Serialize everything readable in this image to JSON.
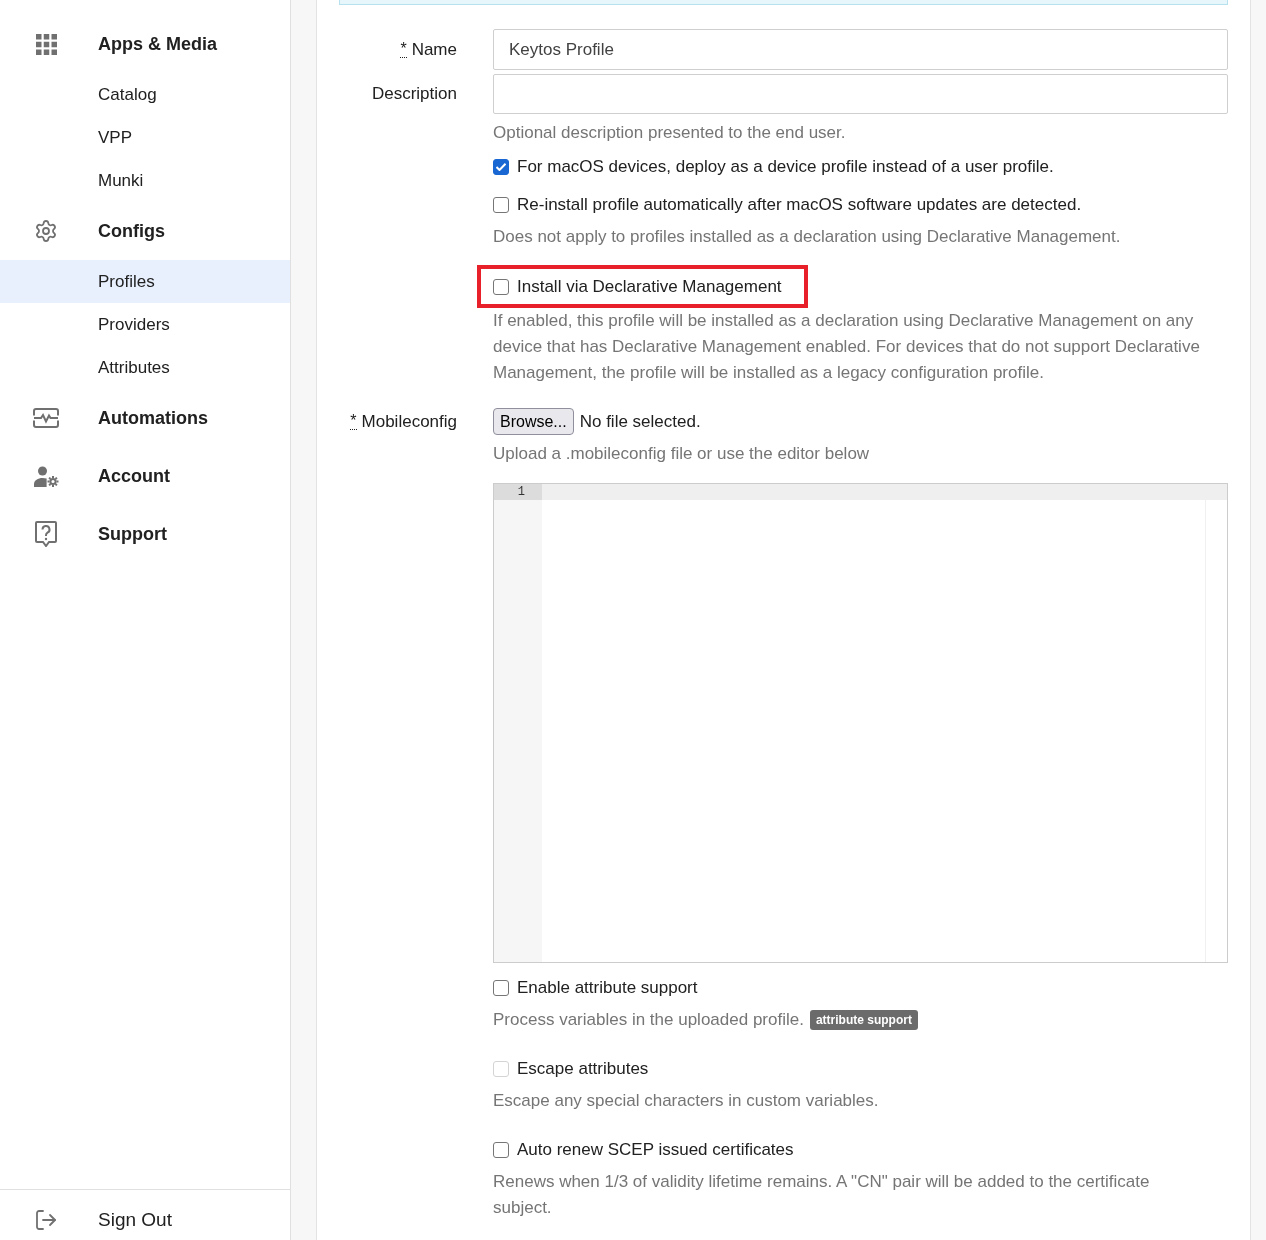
{
  "sidebar": {
    "groups": [
      {
        "label": "Apps & Media",
        "children": [
          {
            "label": "Catalog",
            "selected": false
          },
          {
            "label": "VPP",
            "selected": false
          },
          {
            "label": "Munki",
            "selected": false
          }
        ]
      },
      {
        "label": "Configs",
        "children": [
          {
            "label": "Profiles",
            "selected": true
          },
          {
            "label": "Providers",
            "selected": false
          },
          {
            "label": "Attributes",
            "selected": false
          }
        ]
      },
      {
        "label": "Automations"
      },
      {
        "label": "Account"
      },
      {
        "label": "Support"
      }
    ],
    "sign_out": "Sign Out"
  },
  "form": {
    "name": {
      "required_mark": "*",
      "label": "Name",
      "value": "Keytos Profile"
    },
    "description": {
      "label": "Description",
      "help": "Optional description presented to the end user."
    },
    "options": [
      {
        "label": "For macOS devices, deploy as a device profile instead of a user profile.",
        "checked": true,
        "highlighted": false
      },
      {
        "label": "Re-install profile automatically after macOS software updates are detected.",
        "checked": false,
        "highlighted": false,
        "help": "Does not apply to profiles installed as a declaration using Declarative Management."
      },
      {
        "label": "Install via Declarative Management",
        "checked": false,
        "highlighted": true,
        "help": "If enabled, this profile will be installed as a declaration using Declarative Management on any device that has Declarative Management enabled. For devices that do not support Declarative Management, the profile will be installed as a legacy configuration profile."
      }
    ],
    "mobileconfig": {
      "required_mark": "*",
      "label": "Mobileconfig",
      "button": "Browse...",
      "file_status": "No file selected.",
      "help": "Upload a .mobileconfig file or use the editor below",
      "editor": {
        "line_numbers": [
          "1"
        ]
      }
    },
    "attribute_options": [
      {
        "label": "Enable attribute support",
        "checked": false,
        "disabled": false,
        "help": "Process variables in the uploaded profile.",
        "badge": "attribute support"
      },
      {
        "label": "Escape attributes",
        "checked": false,
        "disabled": true,
        "help": "Escape any special characters in custom variables."
      },
      {
        "label": "Auto renew SCEP issued certificates",
        "checked": false,
        "disabled": false,
        "help": "Renews when 1/3 of validity lifetime remains. A \"CN\" pair will be added to the certificate subject."
      }
    ]
  }
}
